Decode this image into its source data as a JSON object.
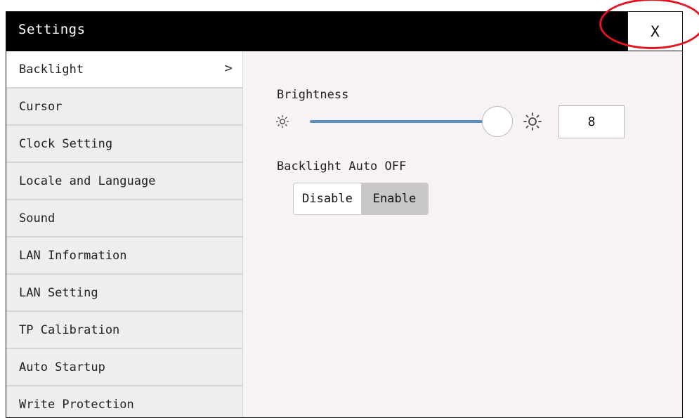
{
  "window": {
    "title": "Settings",
    "close_label": "X"
  },
  "sidebar": {
    "items": [
      {
        "label": "Backlight",
        "active": true
      },
      {
        "label": "Cursor"
      },
      {
        "label": "Clock Setting"
      },
      {
        "label": "Locale and Language"
      },
      {
        "label": "Sound"
      },
      {
        "label": "LAN Information"
      },
      {
        "label": "LAN Setting"
      },
      {
        "label": "TP Calibration"
      },
      {
        "label": "Auto Startup"
      },
      {
        "label": "Write Protection"
      }
    ],
    "active_chevron": ">"
  },
  "backlight": {
    "brightness_label": "Brightness",
    "brightness_value": "8",
    "auto_off_label": "Backlight Auto OFF",
    "options": [
      "Disable",
      "Enable"
    ],
    "selected": "Enable"
  },
  "icons": {
    "dim": "sun-small-icon",
    "bright": "sun-large-icon",
    "chevron": "chevron-right-icon"
  },
  "colors": {
    "titlebar": "#000000",
    "slider_track": "#5b90c5",
    "annotation": "#e4141f",
    "selected_segment": "#c9c6c9"
  }
}
